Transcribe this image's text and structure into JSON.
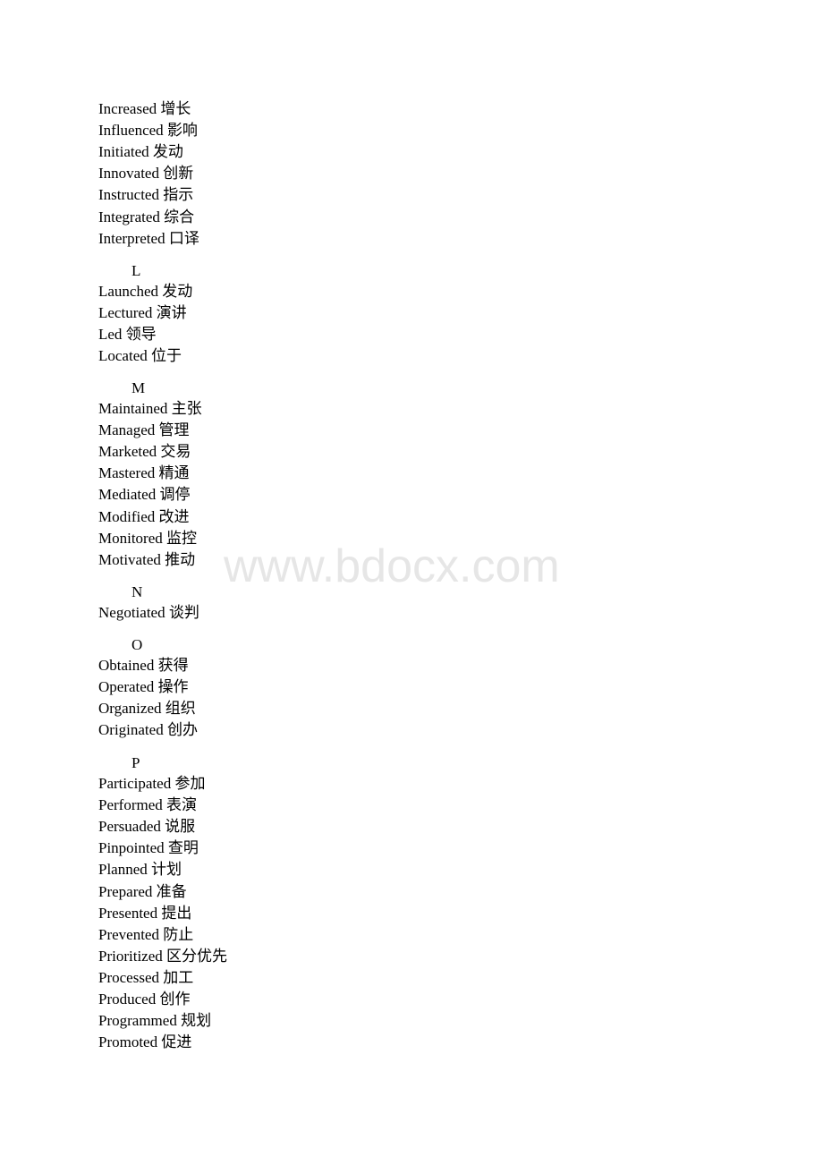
{
  "watermark": "www.bdocx.com",
  "sections": [
    {
      "letter": "",
      "entries": [
        {
          "en": "Increased",
          "zh": "增长"
        },
        {
          "en": "Influenced",
          "zh": "影响"
        },
        {
          "en": "Initiated",
          "zh": "发动"
        },
        {
          "en": "Innovated",
          "zh": "创新"
        },
        {
          "en": "Instructed",
          "zh": "指示"
        },
        {
          "en": "Integrated",
          "zh": "综合"
        },
        {
          "en": "Interpreted",
          "zh": "口译"
        }
      ]
    },
    {
      "letter": "L",
      "entries": [
        {
          "en": "Launched",
          "zh": "发动"
        },
        {
          "en": "Lectured",
          "zh": "演讲"
        },
        {
          "en": "Led",
          "zh": "领导"
        },
        {
          "en": "Located",
          "zh": "位于"
        }
      ]
    },
    {
      "letter": "M",
      "entries": [
        {
          "en": "Maintained",
          "zh": "主张"
        },
        {
          "en": "Managed",
          "zh": "管理"
        },
        {
          "en": "Marketed",
          "zh": "交易"
        },
        {
          "en": "Mastered",
          "zh": "精通"
        },
        {
          "en": "Mediated",
          "zh": "调停"
        },
        {
          "en": "Modified",
          "zh": "改进"
        },
        {
          "en": "Monitored",
          "zh": "监控"
        },
        {
          "en": "Motivated",
          "zh": "推动"
        }
      ]
    },
    {
      "letter": "N",
      "entries": [
        {
          "en": "Negotiated",
          "zh": "谈判"
        }
      ]
    },
    {
      "letter": "O",
      "entries": [
        {
          "en": "Obtained",
          "zh": "获得"
        },
        {
          "en": "Operated",
          "zh": "操作"
        },
        {
          "en": "Organized",
          "zh": "组织"
        },
        {
          "en": "Originated",
          "zh": "创办"
        }
      ]
    },
    {
      "letter": "P",
      "entries": [
        {
          "en": "Participated",
          "zh": "参加"
        },
        {
          "en": "Performed",
          "zh": "表演"
        },
        {
          "en": "Persuaded",
          "zh": "说服"
        },
        {
          "en": "Pinpointed",
          "zh": "查明"
        },
        {
          "en": "Planned",
          "zh": "计划"
        },
        {
          "en": "Prepared",
          "zh": "准备"
        },
        {
          "en": "Presented",
          "zh": "提出"
        },
        {
          "en": "Prevented",
          "zh": "防止"
        },
        {
          "en": "Prioritized",
          "zh": "区分优先"
        },
        {
          "en": "Processed",
          "zh": "加工"
        },
        {
          "en": "Produced",
          "zh": "创作"
        },
        {
          "en": "Programmed",
          "zh": "规划"
        },
        {
          "en": "Promoted",
          "zh": "促进"
        }
      ]
    }
  ]
}
